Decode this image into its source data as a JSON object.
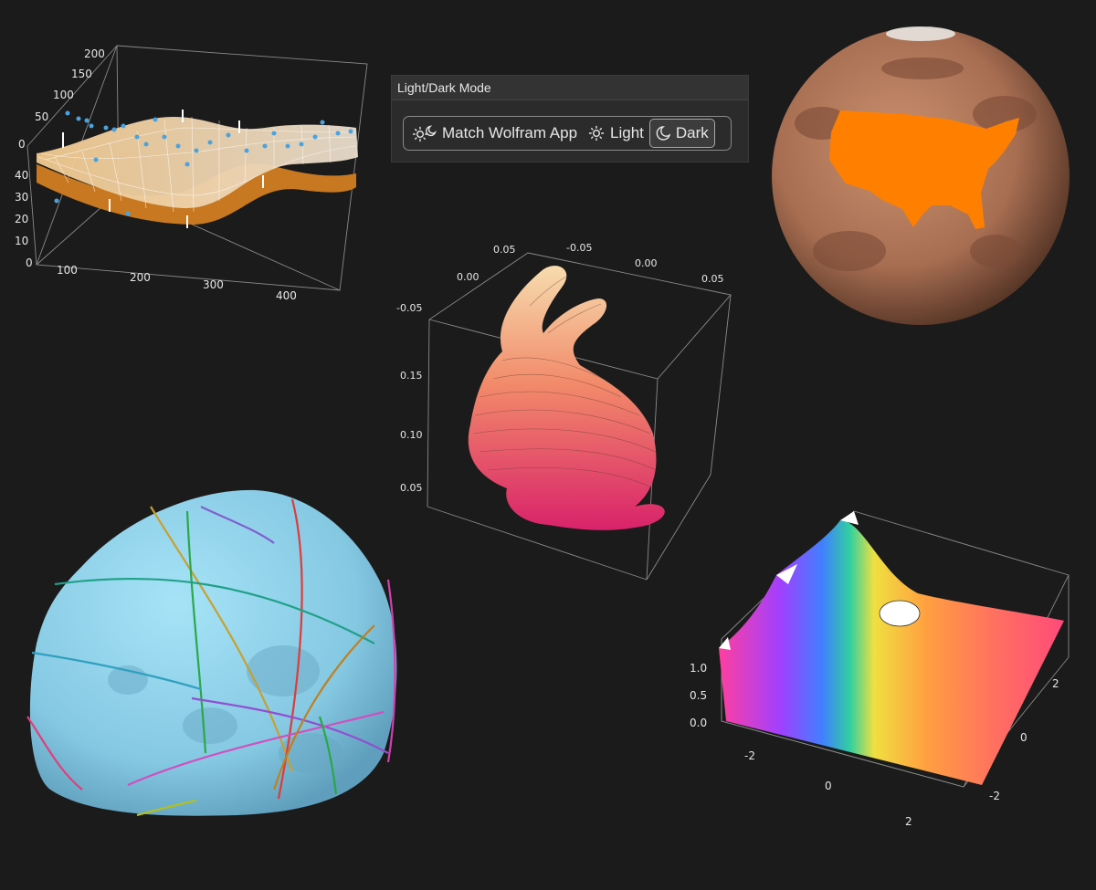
{
  "panel": {
    "title": "Light/Dark Mode",
    "options": [
      {
        "label": "Match Wolfram App",
        "icon": "sun-moon-icon"
      },
      {
        "label": "Light",
        "icon": "sun-icon"
      },
      {
        "label": "Dark",
        "icon": "moon-icon"
      }
    ],
    "selected": "Dark"
  },
  "plot_surface": {
    "z_ticks": [
      "200",
      "150",
      "100",
      "50",
      "0"
    ],
    "y_ticks": [
      "40",
      "30",
      "20",
      "10",
      "0"
    ],
    "x_ticks": [
      "100",
      "200",
      "300",
      "400"
    ]
  },
  "plot_bunny": {
    "top_ticks": [
      "0.05",
      "-0.05",
      "0.00",
      "0.00",
      "0.05"
    ],
    "left_ticks": [
      "-0.05",
      "0.15",
      "0.10",
      "0.05"
    ]
  },
  "plot_complex": {
    "z_ticks": [
      "1.0",
      "0.5",
      "0.0"
    ],
    "x_ticks": [
      "-2",
      "0",
      "2"
    ],
    "y_ticks": [
      "2",
      "0",
      "-2"
    ]
  },
  "colors": {
    "background": "#1b1b1b",
    "mars": "#b27a5c",
    "usa": "#ff8000",
    "asteroid": "#8fd0ea"
  }
}
